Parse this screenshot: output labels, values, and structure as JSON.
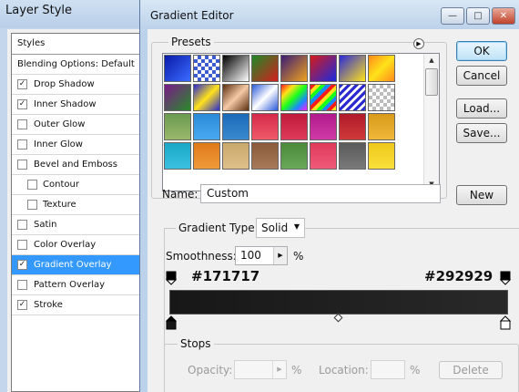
{
  "layer_style": {
    "title": "Layer Style",
    "header": "Styles",
    "items": [
      {
        "label": "Blending Options: Default",
        "checkbox": false
      },
      {
        "label": "Drop Shadow",
        "checkbox": true,
        "checked": "✓"
      },
      {
        "label": "Inner Shadow",
        "checkbox": true,
        "checked": "✓"
      },
      {
        "label": "Outer Glow",
        "checkbox": true,
        "checked": ""
      },
      {
        "label": "Inner Glow",
        "checkbox": true,
        "checked": ""
      },
      {
        "label": "Bevel and Emboss",
        "checkbox": true,
        "checked": ""
      },
      {
        "label": "Contour",
        "checkbox": true,
        "checked": "",
        "sub": true
      },
      {
        "label": "Texture",
        "checkbox": true,
        "checked": "",
        "sub": true
      },
      {
        "label": "Satin",
        "checkbox": true,
        "checked": ""
      },
      {
        "label": "Color Overlay",
        "checkbox": true,
        "checked": ""
      },
      {
        "label": "Gradient Overlay",
        "checkbox": true,
        "checked": "✓",
        "selected": true
      },
      {
        "label": "Pattern Overlay",
        "checkbox": true,
        "checked": ""
      },
      {
        "label": "Stroke",
        "checkbox": true,
        "checked": "✓"
      }
    ]
  },
  "gradient_editor": {
    "title": "Gradient Editor",
    "window_buttons": {
      "minimize": "—",
      "maximize": "□",
      "close": "✕"
    },
    "presets": {
      "label": "Presets",
      "menu_icon": "▶",
      "scroll_up": "▲",
      "scroll_down": "▼",
      "swatches": [
        "linear-gradient(135deg,#0a1aa8,#3a6cff)",
        "repeating-conic-gradient(#3b5ccf 0 25%,#fff 0 50%) 0 0/8px 8px",
        "linear-gradient(135deg,#000,#fff)",
        "linear-gradient(135deg,#1e8a28,#d31e1e)",
        "linear-gradient(135deg,#3a1c74,#f0a21e)",
        "linear-gradient(135deg,#d61a1a,#1a2ae0)",
        "linear-gradient(135deg,#2a2ad8,#ffe21a)",
        "linear-gradient(135deg,#ff8a1a,#ffe21a,#ff8a1a)",
        "linear-gradient(135deg,#7a1a8a,#2a8a2a)",
        "linear-gradient(135deg,#2a2ad0,#ffe21a,#2a2ad0)",
        "linear-gradient(135deg,#5c3012,#f4c9a4,#5c3012)",
        "linear-gradient(135deg,#2b5ad8,#ffffff,#2b5ad8)",
        "linear-gradient(135deg,#ff1a1a,#ffe21a,#1aff1a,#1a8aff,#ff1aff)",
        "repeating-linear-gradient(135deg,#ff1a1a 0 4px,#ffe21a 4px 8px,#1aff1a 8px 12px,#1a8aff 12px 16px)",
        "repeating-linear-gradient(135deg,#2a2ad0 0 3px,#ffffff 3px 6px)",
        "repeating-conic-gradient(#bbbbbb 0 25%,#fff 0 50%) 0 0/8px 8px",
        "linear-gradient(180deg,#6a9a52,#9ab86a)",
        "linear-gradient(180deg,#2a8ad8,#4aaaf0)",
        "linear-gradient(180deg,#1a6ab8,#3a8ad0)",
        "linear-gradient(180deg,#d42a4a,#f05a6a)",
        "linear-gradient(180deg,#c01a3a,#e03a5a)",
        "linear-gradient(180deg,#b01a8a,#d03aa8)",
        "linear-gradient(180deg,#b01a2a,#d03a3a)",
        "linear-gradient(180deg,#d89a1a,#f0b83a)",
        "linear-gradient(180deg,#1aa8c8,#3ac0e0)",
        "linear-gradient(180deg,#e07a1a,#f09a3a)",
        "linear-gradient(180deg,#c8a86a,#e0c08a)",
        "linear-gradient(180deg,#8a5a3a,#a87a5a)",
        "linear-gradient(180deg,#4a8a3a,#6aa85a)",
        "linear-gradient(180deg,#e03a5a,#f05a7a)",
        "linear-gradient(180deg,#5a5a5a,#7a7a7a)",
        "linear-gradient(180deg,#f0c81a,#f8e03a)"
      ]
    },
    "buttons": {
      "ok": "OK",
      "cancel": "Cancel",
      "load": "Load...",
      "save": "Save...",
      "new": "New"
    },
    "name": {
      "label": "Name:",
      "value": "Custom"
    },
    "gradient_type": {
      "label": "Gradient Type:",
      "value": "Solid",
      "arrow": "▼"
    },
    "smoothness": {
      "label": "Smoothness:",
      "value": "100",
      "unit": "%",
      "stepper": "▶"
    },
    "stops_colors": {
      "left_hex": "#171717",
      "right_hex": "#292929"
    },
    "stops": {
      "label": "Stops",
      "opacity_label": "Opacity:",
      "opacity_unit": "%",
      "opacity_stepper": "▶",
      "location_label": "Location:",
      "location_unit": "%",
      "delete": "Delete"
    }
  }
}
